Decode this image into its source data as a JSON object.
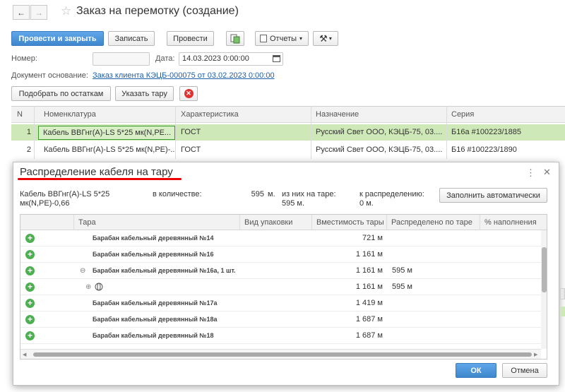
{
  "window": {
    "title": "Заказ на перемотку (создание)"
  },
  "toolbar": {
    "post_close": "Провести и закрыть",
    "save": "Записать",
    "post": "Провести",
    "reports": "Отчеты"
  },
  "form": {
    "number_label": "Номер:",
    "number_value": "",
    "date_label": "Дата:",
    "date_value": "14.03.2023  0:00:00",
    "basis_label": "Документ основание:",
    "basis_link": "Заказ клиента КЭЦБ-000075 от 03.02.2023 0:00:00"
  },
  "actions": {
    "pick_by_stock": "Подобрать по остаткам",
    "specify_tare": "Указать тару"
  },
  "table": {
    "columns": [
      "N",
      "Номенклатура",
      "Характеристика",
      "Назначение",
      "Серия"
    ],
    "rows": [
      {
        "n": "1",
        "nomenclature": "Кабель ВВГнг(А)-LS 5*25 мк(N,PE...",
        "characteristic": "ГОСТ",
        "purpose": "Русский Свет ООО, КЭЦБ-75, 03....",
        "series": "Б16а #100223/1885"
      },
      {
        "n": "2",
        "nomenclature": "Кабель ВВГнг(А)-LS 5*25 мк(N,PE)-...",
        "characteristic": "ГОСТ",
        "purpose": "Русский Свет ООО, КЭЦБ-75, 03....",
        "series": "Б16 #100223/1890"
      }
    ]
  },
  "dialog": {
    "title": "Распределение кабеля на тару",
    "cable_name": "Кабель ВВГнг(А)-LS 5*25 мк(N,PE)-0,66",
    "qty_label": "в количестве:",
    "qty_value": "595",
    "qty_unit": "м.",
    "on_tare_label": "из них на таре:",
    "on_tare_value": "595",
    "on_tare_unit": "м.",
    "to_distribute_label": "к распределению:",
    "to_distribute_value": "0",
    "to_distribute_unit": "м.",
    "fill_auto": "Заполнить автоматически",
    "columns": [
      "Тара",
      "Вид упаковки",
      "Вместимость тары",
      "Распределено по таре",
      "% наполнения"
    ],
    "rows": [
      {
        "tare": "Барабан кабельный деревянный №14",
        "capacity": "721 м",
        "distributed": ""
      },
      {
        "tare": "Барабан кабельный деревянный №16",
        "capacity": "1 161 м",
        "distributed": ""
      },
      {
        "tare": "Барабан кабельный деревянный №16а, 1 шт.",
        "capacity": "1 161 м",
        "distributed": "595 м"
      },
      {
        "tare": "",
        "capacity": "1 161 м",
        "distributed": "595 м"
      },
      {
        "tare": "Барабан кабельный деревянный №17а",
        "capacity": "1 419 м",
        "distributed": ""
      },
      {
        "tare": "Барабан кабельный деревянный №18а",
        "capacity": "1 687 м",
        "distributed": ""
      },
      {
        "tare": "Барабан кабельный деревянный №18",
        "capacity": "1 687 м",
        "distributed": ""
      }
    ],
    "ok": "ОК",
    "cancel": "Отмена"
  }
}
